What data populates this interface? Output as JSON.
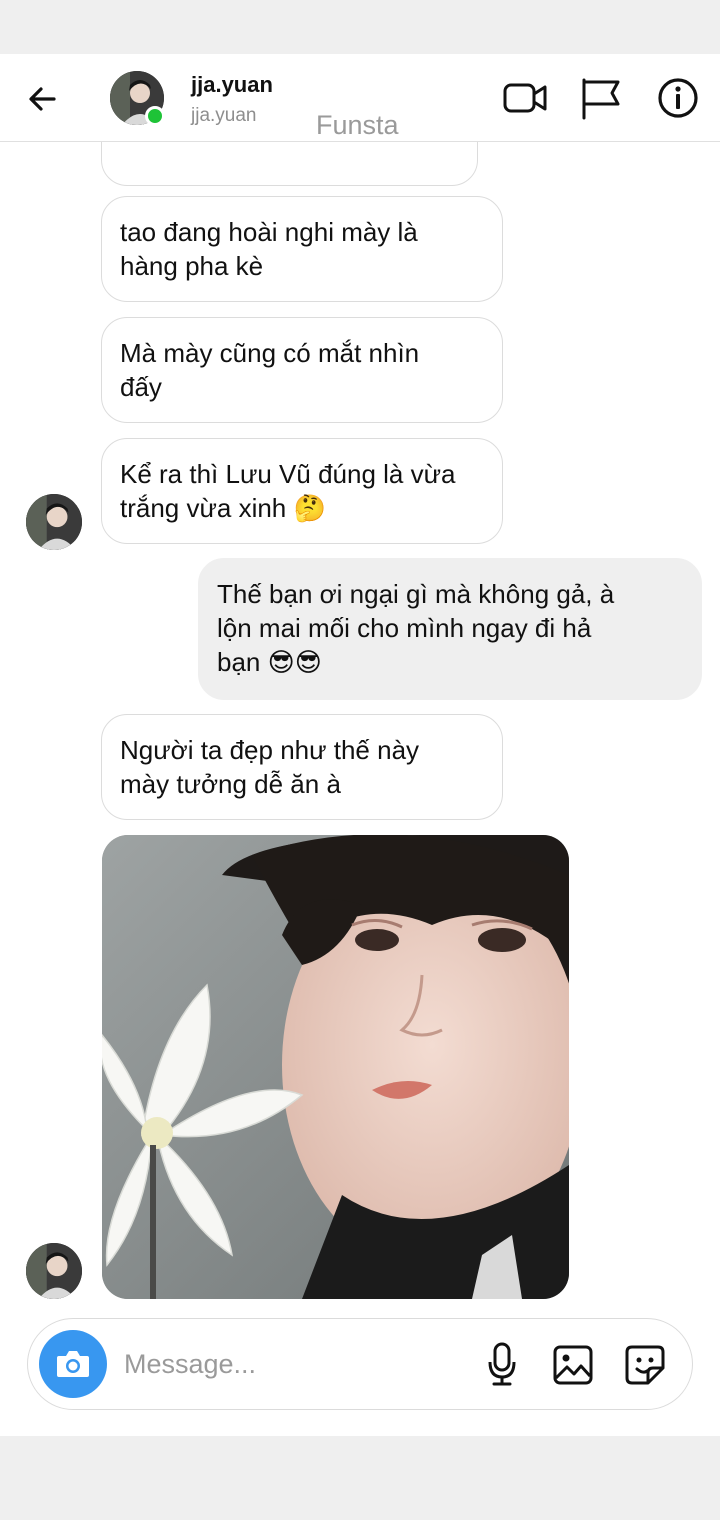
{
  "header": {
    "name": "jja.yuan",
    "handle": "jja.yuan",
    "watermark": "Funsta",
    "icons": [
      "back-arrow-icon",
      "video-call-icon",
      "flag-icon",
      "info-icon"
    ]
  },
  "messages": [
    {
      "direction": "in",
      "text": ""
    },
    {
      "direction": "in",
      "text": "tao đang hoài nghi mày là\nhàng pha kè"
    },
    {
      "direction": "in",
      "text": "Mà mày cũng có mắt nhìn\nđấy"
    },
    {
      "direction": "in",
      "text": "Kể ra thì Lưu Vũ đúng là vừa\ntrắng vừa xinh 🤔"
    },
    {
      "direction": "out",
      "text": "Thế bạn ơi ngại gì mà không gả, à\nlộn mai mối cho mình ngay đi hả\nbạn 😎😎"
    },
    {
      "direction": "in",
      "text": "Người ta đẹp như thế này\nmày tưởng dễ ăn à"
    },
    {
      "direction": "in",
      "type": "photo"
    }
  ],
  "composer": {
    "placeholder": "Message...",
    "icons": [
      "camera-icon",
      "microphone-icon",
      "gallery-icon",
      "sticker-icon"
    ]
  },
  "colors": {
    "accent": "#3897f0",
    "online": "#1ec337",
    "outgoing_bubble": "#efefef",
    "bubble_border": "#dcdcdc"
  }
}
